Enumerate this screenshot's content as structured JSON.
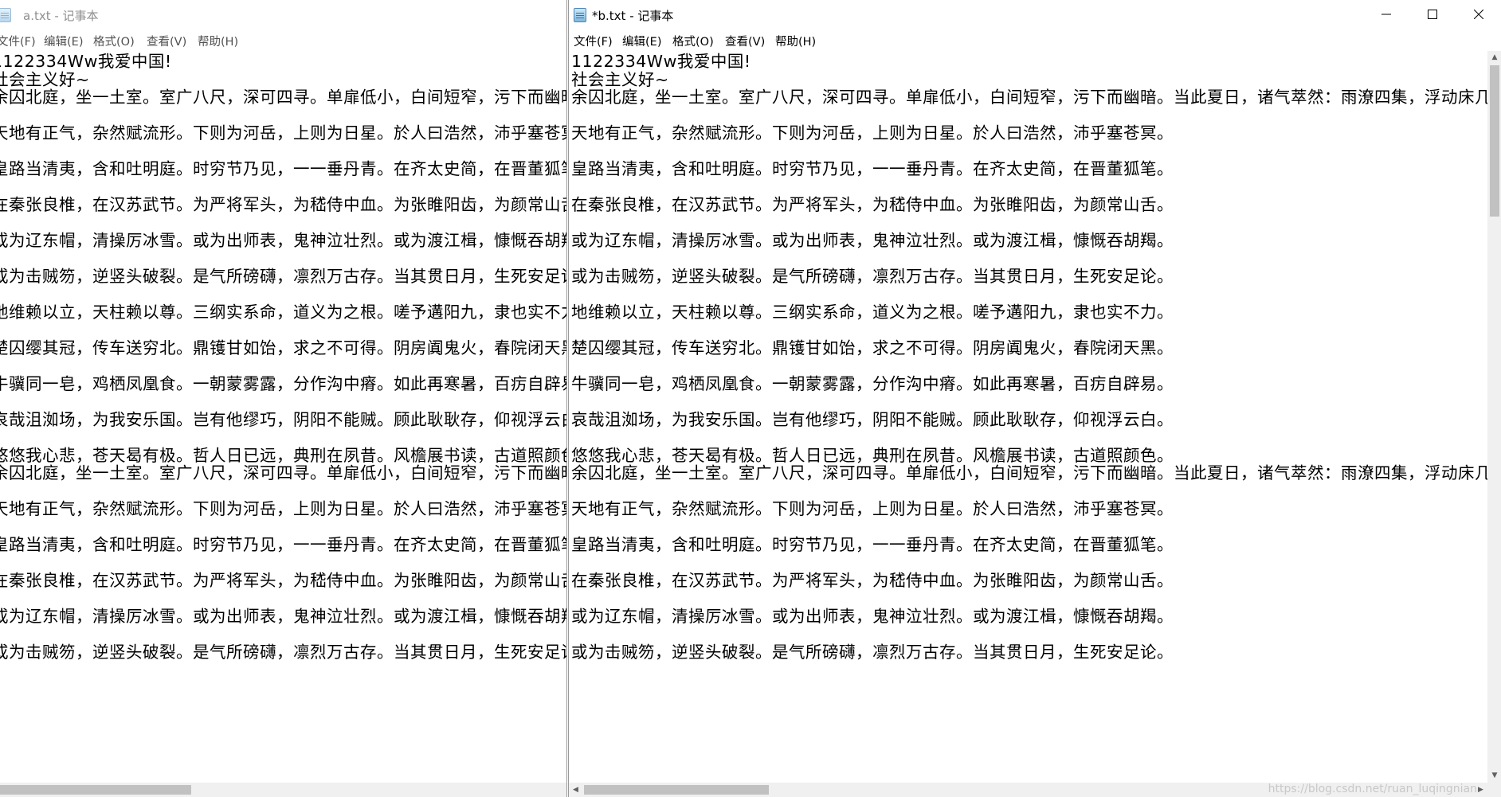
{
  "window_a": {
    "title": "a.txt - 记事本",
    "menu": [
      "文件(F)",
      "编辑(E)",
      "格式(O)",
      "查看(V)",
      "帮助(H)"
    ],
    "lines": [
      "1122334Ww我爱中国!",
      "社会主义好~",
      "余囚北庭，坐一土室。室广八尺，深可四寻。单扉低小，白间短窄，污下而幽暗。",
      "天地有正气，杂然赋流形。下则为河岳，上则为日星。於人曰浩然，沛乎塞苍冥。",
      "皇路当清夷，含和吐明庭。时穷节乃见，一一垂丹青。在齐太史简，在晋董狐笔。",
      "在秦张良椎，在汉苏武节。为严将军头，为嵇侍中血。为张睢阳齿，为颜常山舌。",
      "或为辽东帽，清操厉冰雪。或为出师表，鬼神泣壮烈。或为渡江楫，慷慨吞胡羯。",
      "或为击贼笏，逆竖头破裂。是气所磅礴，凛烈万古存。当其贯日月，生死安足论。",
      "地维赖以立，天柱赖以尊。三纲实系命，道义为之根。嗟予遘阳九，隶也实不力。",
      "楚囚缨其冠，传车送穷北。鼎镬甘如饴，求之不可得。阴房阗鬼火，春院闭天黑。",
      "牛骥同一皂，鸡栖凤凰食。一朝蒙雾露，分作沟中瘠。如此再寒暑，百疠自辟易。",
      "哀哉沮洳场，为我安乐国。岂有他缪巧，阴阳不能贼。顾此耿耿存，仰视浮云白。",
      "悠悠我心悲，苍天曷有极。哲人日已远，典刑在夙昔。风檐展书读，古道照颜色。",
      "余囚北庭，坐一土室。室广八尺，深可四寻。单扉低小，白间短窄，污下而幽暗。",
      "天地有正气，杂然赋流形。下则为河岳，上则为日星。於人曰浩然，沛乎塞苍冥。",
      "皇路当清夷，含和吐明庭。时穷节乃见，一一垂丹青。在齐太史简，在晋董狐笔。",
      "在秦张良椎，在汉苏武节。为严将军头，为嵇侍中血。为张睢阳齿，为颜常山舌。",
      "或为辽东帽，清操厉冰雪。或为出师表，鬼神泣壮烈。或为渡江楫，慷慨吞胡羯。",
      "或为击贼笏，逆竖头破裂。是气所磅礴，凛烈万古存。当其贯日月，生死安足论。"
    ]
  },
  "window_b": {
    "title": "*b.txt - 记事本",
    "menu": [
      "文件(F)",
      "编辑(E)",
      "格式(O)",
      "查看(V)",
      "帮助(H)"
    ],
    "controls": {
      "minimize": "—",
      "maximize": "☐",
      "close": "✕"
    },
    "lines": [
      "1122334Ww我爱中国!",
      "社会主义好~",
      "余囚北庭，坐一土室。室广八尺，深可四寻。单扉低小，白间短窄，污下而幽暗。当此夏日，诸气萃然：雨潦四集，浮动床几，时",
      "天地有正气，杂然赋流形。下则为河岳，上则为日星。於人曰浩然，沛乎塞苍冥。",
      "皇路当清夷，含和吐明庭。时穷节乃见，一一垂丹青。在齐太史简，在晋董狐笔。",
      "在秦张良椎，在汉苏武节。为严将军头，为嵇侍中血。为张睢阳齿，为颜常山舌。",
      "或为辽东帽，清操厉冰雪。或为出师表，鬼神泣壮烈。或为渡江楫，慷慨吞胡羯。",
      "或为击贼笏，逆竖头破裂。是气所磅礴，凛烈万古存。当其贯日月，生死安足论。",
      "地维赖以立，天柱赖以尊。三纲实系命，道义为之根。嗟予遘阳九，隶也实不力。",
      "楚囚缨其冠，传车送穷北。鼎镬甘如饴，求之不可得。阴房阗鬼火，春院闭天黑。",
      "牛骥同一皂，鸡栖凤凰食。一朝蒙雾露，分作沟中瘠。如此再寒暑，百疠自辟易。",
      "哀哉沮洳场，为我安乐国。岂有他缪巧，阴阳不能贼。顾此耿耿存，仰视浮云白。",
      "悠悠我心悲，苍天曷有极。哲人日已远，典刑在夙昔。风檐展书读，古道照颜色。",
      "余囚北庭，坐一土室。室广八尺，深可四寻。单扉低小，白间短窄，污下而幽暗。当此夏日，诸气萃然：雨潦四集，浮动床几，时",
      "天地有正气，杂然赋流形。下则为河岳，上则为日星。於人曰浩然，沛乎塞苍冥。",
      "皇路当清夷，含和吐明庭。时穷节乃见，一一垂丹青。在齐太史简，在晋董狐笔。",
      "在秦张良椎，在汉苏武节。为严将军头，为嵇侍中血。为张睢阳齿，为颜常山舌。",
      "或为辽东帽，清操厉冰雪。或为出师表，鬼神泣壮烈。或为渡江楫，慷慨吞胡羯。",
      "或为击贼笏，逆竖头破裂。是气所磅礴，凛烈万古存。当其贯日月，生死安足论。"
    ]
  },
  "watermark": "https://blog.csdn.net/ruan_luqingnian"
}
